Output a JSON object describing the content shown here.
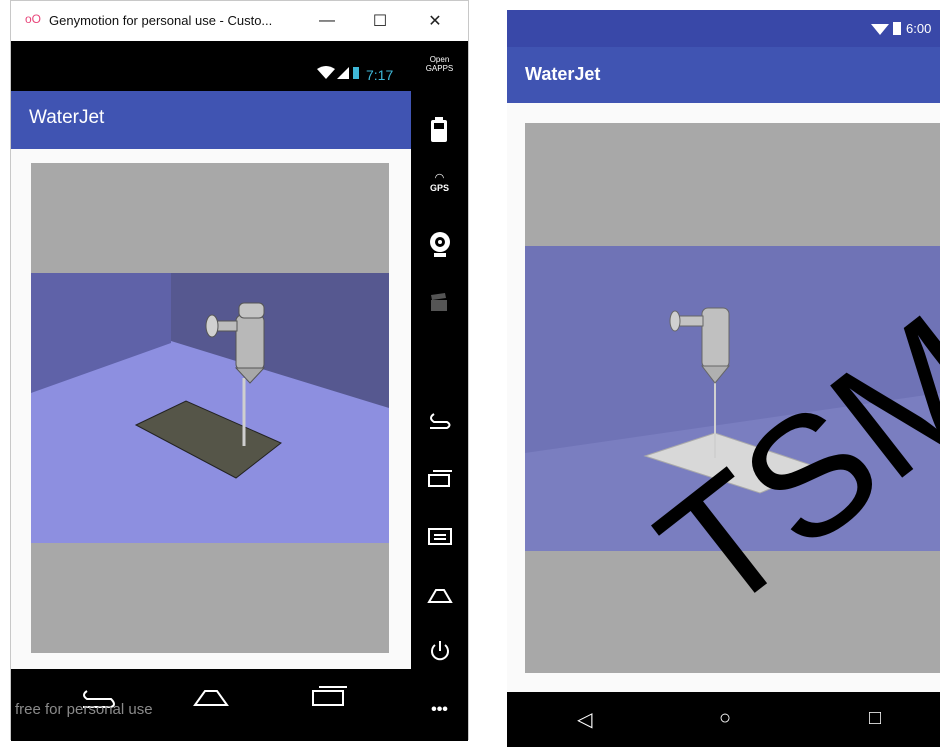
{
  "left_window": {
    "title": "Genymotion for personal use - Custo...",
    "controls": {
      "minimize": "—",
      "maximize": "☐",
      "close": "✕"
    },
    "status_time": "7:17",
    "app_title": "WaterJet",
    "watermark": "free for personal use",
    "sidebar": {
      "opengapps_line1": "Open",
      "opengapps_line2": "GAPPS",
      "gps_label": "GPS",
      "more_label": "•••"
    }
  },
  "right_device": {
    "status_time": "6:00",
    "app_title": "WaterJet"
  },
  "overlay_text": "TSM",
  "colors": {
    "appbar": "#4054b2",
    "gl_background": "#a8a8a8",
    "scene_floor": "#8d8fe0",
    "scene_wall": "#6668a8",
    "right_scene": "#7a7ec0"
  }
}
